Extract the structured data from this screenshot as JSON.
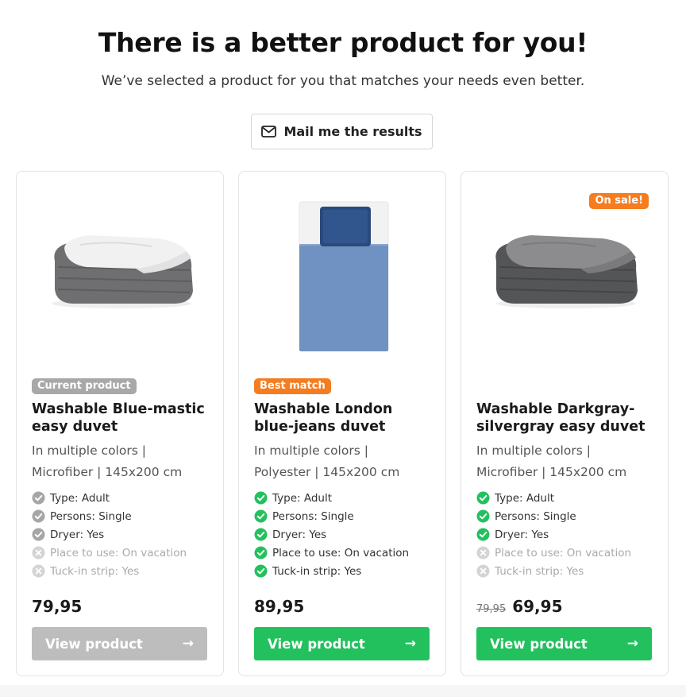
{
  "header": {
    "title": "There is a better product for you!",
    "subtitle": "We’ve selected a product for you that matches your needs even better.",
    "mail_button": "Mail me the results"
  },
  "colors": {
    "green": "#22c15e",
    "orange": "#f57c1f",
    "gray_button": "#bdbdbd",
    "gray_badge": "#a8a8a8"
  },
  "cards": [
    {
      "badge": "Current product",
      "sale_badge": "",
      "name": "Washable Blue-mastic easy duvet",
      "desc_line1": "In multiple colors |",
      "desc_line2": "Microfiber | 145x200 cm",
      "features": [
        {
          "text": "Type: Adult",
          "status": "check-gray"
        },
        {
          "text": "Persons: Single",
          "status": "check-gray"
        },
        {
          "text": "Dryer: Yes",
          "status": "check-gray"
        },
        {
          "text": "Place to use: On vacation",
          "status": "cross"
        },
        {
          "text": "Tuck-in strip: Yes",
          "status": "cross"
        }
      ],
      "old_price": "",
      "price": "79,95",
      "button": "View product",
      "button_arrow": "→",
      "image": "folded-duvet-white-gray"
    },
    {
      "badge": "Best match",
      "sale_badge": "",
      "name": "Washable London blue-jeans duvet",
      "desc_line1": "In multiple colors |",
      "desc_line2": "Polyester | 145x200 cm",
      "features": [
        {
          "text": "Type: Adult",
          "status": "check-green"
        },
        {
          "text": "Persons: Single",
          "status": "check-green"
        },
        {
          "text": "Dryer: Yes",
          "status": "check-green"
        },
        {
          "text": "Place to use: On vacation",
          "status": "check-green"
        },
        {
          "text": "Tuck-in strip: Yes",
          "status": "check-green"
        }
      ],
      "old_price": "",
      "price": "89,95",
      "button": "View product",
      "button_arrow": "→",
      "image": "bed-blue-duvet"
    },
    {
      "badge": "",
      "sale_badge": "On sale!",
      "name": "Washable Darkgray-silvergray easy duvet",
      "desc_line1": "In multiple colors |",
      "desc_line2": "Microfiber | 145x200 cm",
      "features": [
        {
          "text": "Type: Adult",
          "status": "check-green"
        },
        {
          "text": "Persons: Single",
          "status": "check-green"
        },
        {
          "text": "Dryer: Yes",
          "status": "check-green"
        },
        {
          "text": "Place to use: On vacation",
          "status": "cross"
        },
        {
          "text": "Tuck-in strip: Yes",
          "status": "cross"
        }
      ],
      "old_price": "79,95",
      "price": "69,95",
      "button": "View product",
      "button_arrow": "→",
      "image": "folded-duvet-dark-gray"
    }
  ]
}
